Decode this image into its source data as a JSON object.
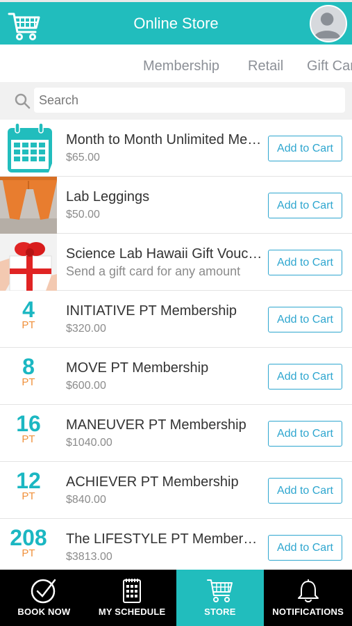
{
  "header": {
    "title": "Online Store",
    "cart_icon": "shopping-cart-icon",
    "avatar_icon": "user-avatar-icon"
  },
  "tabs": [
    {
      "label": "Membership"
    },
    {
      "label": "Retail"
    },
    {
      "label": "Gift Car"
    }
  ],
  "search": {
    "placeholder": "Search",
    "value": ""
  },
  "colors": {
    "primary": "#21bdbd",
    "button_border": "#2ea6cf",
    "pt_number": "#1bb7c2",
    "pt_label": "#f0903a"
  },
  "products": [
    {
      "name": "Month to Month Unlimited Membership",
      "price": "$65.00",
      "button": "Add to Cart",
      "image": "calendar-icon"
    },
    {
      "name": "Lab Leggings",
      "price": "$50.00",
      "button": "Add to Cart",
      "image": "leggings-photo"
    },
    {
      "name": "Science Lab Hawaii Gift Voucher",
      "price": "Send a gift card for any amount",
      "button": "Add to Cart",
      "image": "gift-box-photo"
    },
    {
      "name": "INITIATIVE PT Membership",
      "price": "$320.00",
      "button": "Add to Cart",
      "badge_number": "4",
      "badge_label": "PT"
    },
    {
      "name": "MOVE PT Membership",
      "price": "$600.00",
      "button": "Add to Cart",
      "badge_number": "8",
      "badge_label": "PT"
    },
    {
      "name": "MANEUVER PT Membership",
      "price": "$1040.00",
      "button": "Add to Cart",
      "badge_number": "16",
      "badge_label": "PT"
    },
    {
      "name": "ACHIEVER PT Membership",
      "price": "$840.00",
      "button": "Add to Cart",
      "badge_number": "12",
      "badge_label": "PT"
    },
    {
      "name": "The LIFESTYLE PT Membership",
      "price": "$3813.00",
      "button": "Add to Cart",
      "badge_number": "208",
      "badge_label": "PT"
    }
  ],
  "bottom_nav": [
    {
      "label": "BOOK NOW",
      "icon": "checkmark-circle-icon",
      "active": false
    },
    {
      "label": "MY SCHEDULE",
      "icon": "schedule-icon",
      "active": false
    },
    {
      "label": "STORE",
      "icon": "cart-icon",
      "active": true
    },
    {
      "label": "NOTIFICATIONS",
      "icon": "bell-icon",
      "active": false
    }
  ]
}
